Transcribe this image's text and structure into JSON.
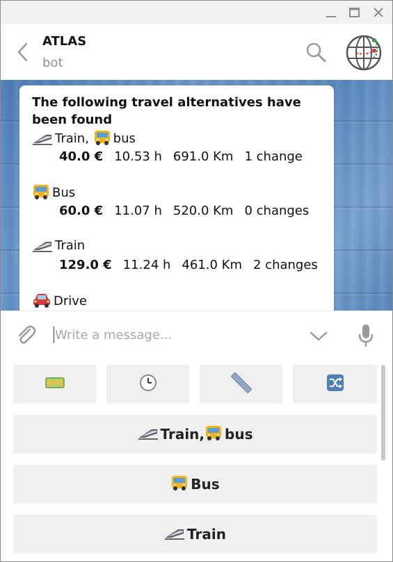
{
  "window": {
    "controls": [
      "minimize-icon",
      "maximize-icon",
      "close-icon"
    ]
  },
  "header": {
    "title": "ATLAS",
    "subtitle": "bot"
  },
  "message": {
    "title": "The following travel alternatives have been found",
    "options": [
      {
        "name": "Train, ",
        "name2": "bus",
        "icons": [
          "train-icon",
          "bus-icon"
        ],
        "price": "40.0 €",
        "duration": "10.53 h",
        "distance": "691.0 Km",
        "changes": "1 change"
      },
      {
        "name": "Bus",
        "icons": [
          "bus-icon"
        ],
        "price": "60.0 €",
        "duration": "11.07 h",
        "distance": "520.0 Km",
        "changes": "0 changes"
      },
      {
        "name": "Train",
        "icons": [
          "train-icon"
        ],
        "price": "129.0 €",
        "duration": "11.24 h",
        "distance": "461.0 Km",
        "changes": "2 changes"
      },
      {
        "name": "Drive",
        "icons": [
          "car-icon"
        ]
      }
    ]
  },
  "input": {
    "placeholder": "Write a message..."
  },
  "keyboard": {
    "sort_buttons": [
      "money-icon",
      "clock-icon",
      "ruler-icon",
      "shuffle-icon"
    ],
    "options": [
      {
        "label": "Train, ",
        "label2": "bus",
        "icons": [
          "train-icon",
          "bus-icon"
        ]
      },
      {
        "label": "Bus",
        "icons": [
          "bus-icon"
        ]
      },
      {
        "label": "Train",
        "icons": [
          "train-icon"
        ]
      }
    ]
  },
  "colors": {
    "header_bg": "#ffffff",
    "chat_bg": "#5b89bd",
    "bubble_bg": "#ffffff",
    "button_bg": "#f0f0f0",
    "muted_text": "#8f8f8f"
  }
}
